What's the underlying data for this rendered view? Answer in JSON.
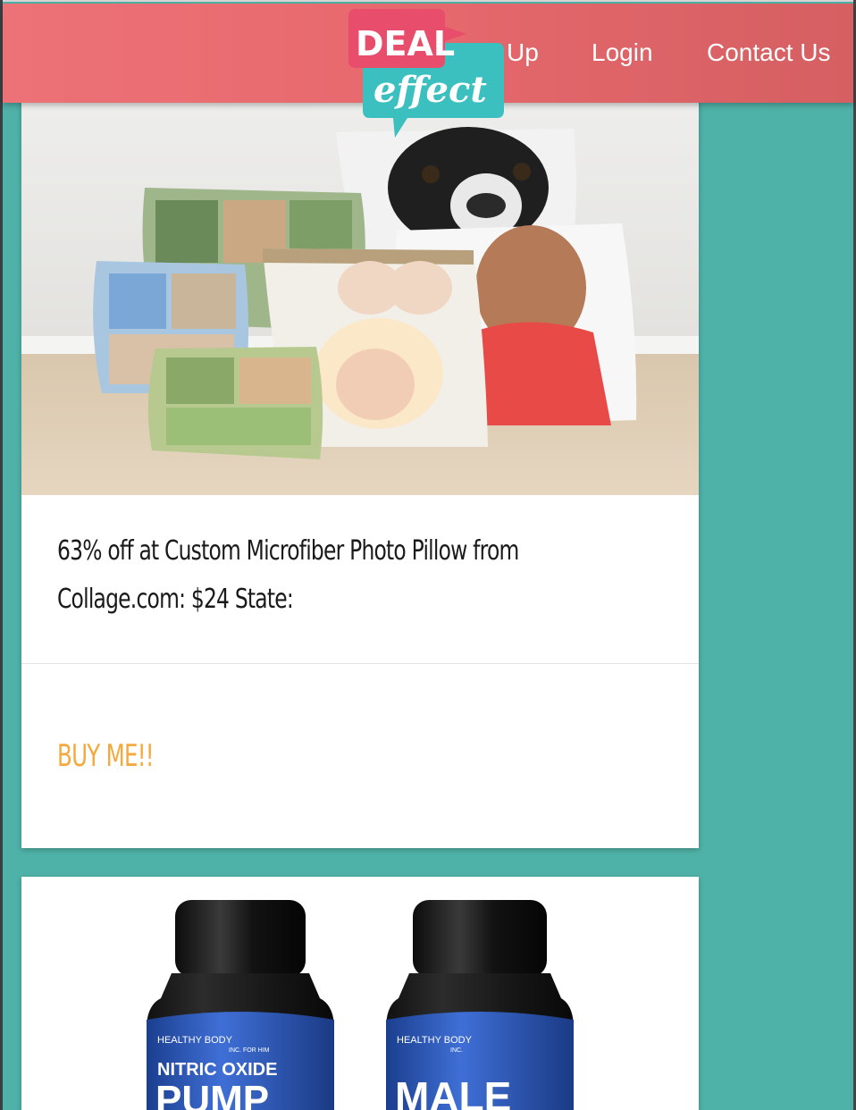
{
  "nav": {
    "links": [
      {
        "label": "Up"
      },
      {
        "label": "Login"
      },
      {
        "label": "Contact Us"
      }
    ]
  },
  "logo": {
    "line1": "DEAL",
    "line2": "effect",
    "colors": {
      "pink": "#e84d6b",
      "teal": "#3bbfbf"
    }
  },
  "deals": [
    {
      "title": "63% off at Custom Microfiber Photo Pillow from Collage.com: $24 State:",
      "buy_label": "BUY ME!!",
      "image": "photo-pillows-image"
    },
    {
      "image": "supplement-bottles-image",
      "bottles": [
        {
          "brand": "HEALTHY BODY",
          "subline": "INC. FOR HIM",
          "name": "NITRIC OXIDE",
          "big": "PUMP"
        },
        {
          "brand": "HEALTHY BODY",
          "subline": "INC.",
          "name": "",
          "big": "MALE"
        }
      ]
    }
  ],
  "colors": {
    "background": "#4fb2a8",
    "header": "#e86a6f",
    "buy": "#f5a83c"
  }
}
